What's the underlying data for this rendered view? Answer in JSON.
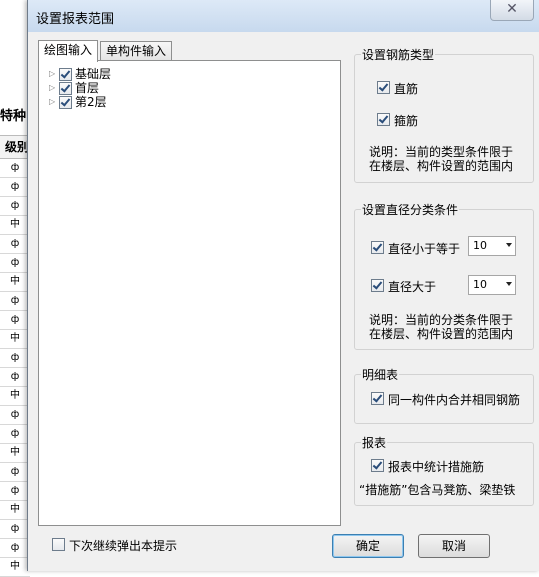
{
  "background": {
    "title": "特种",
    "column_header": "级别",
    "cells": [
      "ф",
      "ф",
      "ф",
      "中",
      "ф",
      "ф",
      "中",
      "ф",
      "ф",
      "中",
      "ф",
      "ф",
      "中",
      "ф",
      "ф",
      "中",
      "ф",
      "ф",
      "中",
      "ф",
      "ф",
      "中"
    ]
  },
  "dialog": {
    "title": "设置报表范围",
    "close_label": "✕",
    "tabs": [
      "绘图输入",
      "单构件输入"
    ],
    "tree": [
      {
        "label": "基础层",
        "checked": true
      },
      {
        "label": "首层",
        "checked": true
      },
      {
        "label": "第2层",
        "checked": true
      }
    ],
    "rebar_type": {
      "title": "设置钢筋类型",
      "straight": "直筋",
      "stirrup": "箍筋",
      "note_line1": "说明：当前的类型条件限于",
      "note_line2": "在楼层、构件设置的范围内"
    },
    "diameter": {
      "title": "设置直径分类条件",
      "le_label": "直径小于等于",
      "le_value": "10",
      "gt_label": "直径大于",
      "gt_value": "10",
      "note_line1": "说明：当前的分类条件限于",
      "note_line2": "在楼层、构件设置的范围内"
    },
    "detail": {
      "title": "明细表",
      "merge_label": "同一构件内合并相同钢筋"
    },
    "report": {
      "title": "报表",
      "count_label": "报表中统计措施筋",
      "note": "“措施筋”包含马凳筋、梁垫铁"
    },
    "show_again_label": "下次继续弹出本提示",
    "ok_label": "确定",
    "cancel_label": "取消"
  }
}
